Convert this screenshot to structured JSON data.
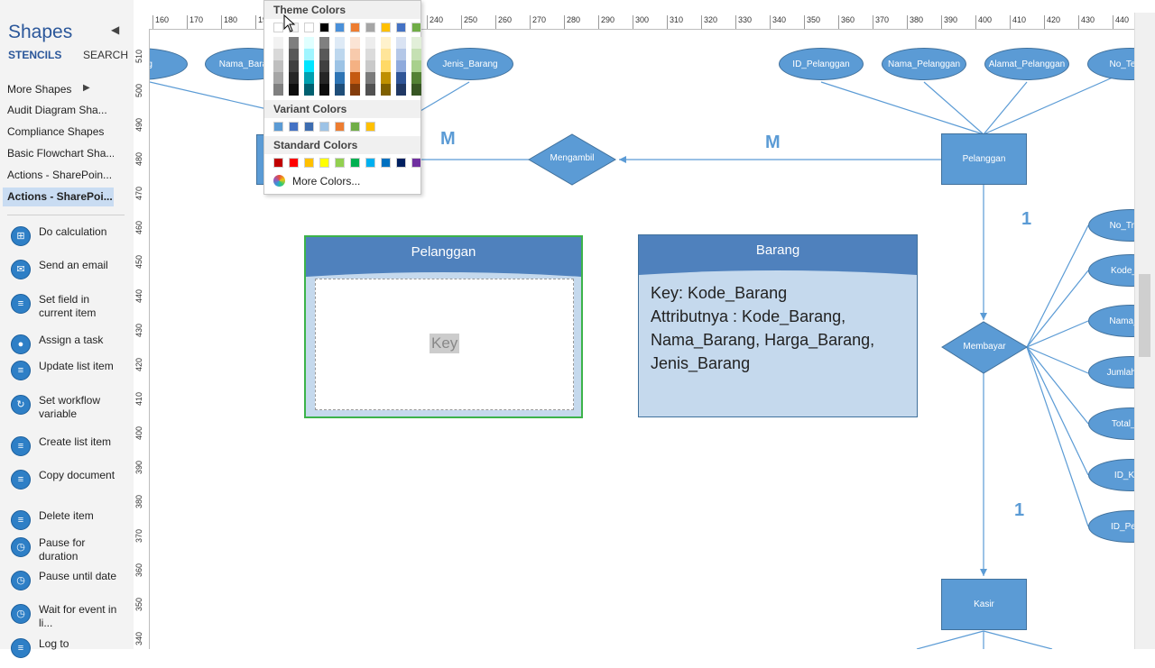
{
  "pane": {
    "title": "Shapes",
    "tab_stencils": "STENCILS",
    "tab_search": "SEARCH",
    "more_shapes": "More Shapes",
    "stencils": [
      {
        "label": "Audit Diagram Sha...",
        "active": false
      },
      {
        "label": "Compliance Shapes",
        "active": false
      },
      {
        "label": "Basic Flowchart Sha...",
        "active": false
      },
      {
        "label": "Actions - SharePoin...",
        "active": false
      },
      {
        "label": "Actions - SharePoi...",
        "active": true
      }
    ],
    "actions": [
      {
        "label": "Do calculation",
        "icon": "calculator-icon"
      },
      {
        "label": "Send an email",
        "icon": "email-icon"
      },
      {
        "label": "Set field in current item",
        "icon": "list-icon"
      },
      {
        "label": "Assign a task",
        "icon": "user-icon"
      },
      {
        "label": "Update list item",
        "icon": "list-icon"
      },
      {
        "label": "Set workflow variable",
        "icon": "variable-icon"
      },
      {
        "label": "Create list item",
        "icon": "list-icon"
      },
      {
        "label": "Copy document",
        "icon": "document-icon"
      },
      {
        "label": "Delete item",
        "icon": "list-icon"
      },
      {
        "label": "Pause for duration",
        "icon": "clock-icon"
      },
      {
        "label": "Pause until date",
        "icon": "clock-icon"
      },
      {
        "label": "Wait for event in li...",
        "icon": "clock-icon"
      },
      {
        "label": "Log to",
        "icon": "log-icon"
      }
    ]
  },
  "ruler": {
    "h_ticks": [
      "160",
      "170",
      "180",
      "190",
      "200",
      "210",
      "220",
      "230",
      "240",
      "250",
      "260",
      "270",
      "280",
      "290",
      "300",
      "310",
      "320",
      "330",
      "340",
      "350",
      "360",
      "370",
      "380",
      "390",
      "400",
      "410",
      "420",
      "430",
      "440"
    ],
    "v_ticks": [
      "510",
      "500",
      "490",
      "480",
      "470",
      "460",
      "450",
      "440",
      "430",
      "420",
      "410",
      "400",
      "390",
      "380",
      "370",
      "360",
      "350",
      "340"
    ]
  },
  "picker": {
    "theme_title": "Theme Colors",
    "variant_title": "Variant Colors",
    "standard_title": "Standard Colors",
    "more_colors": "More Colors...",
    "theme_top": [
      "#ffffff",
      "#f2f2f2",
      "#ffffff",
      "#000000",
      "#4a90d9",
      "#ed7d31",
      "#a5a5a5",
      "#ffc000",
      "#4472c4",
      "#70ad47"
    ],
    "theme_shades": [
      [
        "#f2f2f2",
        "#d9d9d9",
        "#bfbfbf",
        "#a6a6a6",
        "#808080"
      ],
      [
        "#7f7f7f",
        "#595959",
        "#404040",
        "#262626",
        "#0d0d0d"
      ],
      [
        "#e0ffff",
        "#a0f5ff",
        "#00e5ff",
        "#00a0b0",
        "#006070"
      ],
      [
        "#808080",
        "#595959",
        "#404040",
        "#262626",
        "#0d0d0d"
      ],
      [
        "#deeaf6",
        "#bdd7ee",
        "#9cc3e5",
        "#2e75b5",
        "#1f4e79"
      ],
      [
        "#fbe4d5",
        "#f7caac",
        "#f4b183",
        "#c55a11",
        "#843c0b"
      ],
      [
        "#ededed",
        "#dbdbdb",
        "#c9c9c9",
        "#7b7b7b",
        "#525252"
      ],
      [
        "#fff2cc",
        "#ffe599",
        "#ffd966",
        "#bf9000",
        "#7f6000"
      ],
      [
        "#dae3f3",
        "#b4c7e7",
        "#8faadc",
        "#2f5597",
        "#203864"
      ],
      [
        "#e2efd9",
        "#c5e0b3",
        "#a8d08d",
        "#538135",
        "#375623"
      ]
    ],
    "variant": [
      "#5b9bd5",
      "#4472c4",
      "#3e6db0",
      "#9dc3e6",
      "#ed7d31",
      "#70ad47",
      "#ffc000"
    ],
    "standard": [
      "#c00000",
      "#ff0000",
      "#ffc000",
      "#ffff00",
      "#92d050",
      "#00b050",
      "#00b0f0",
      "#0070c0",
      "#002060",
      "#7030a0"
    ]
  },
  "diagram": {
    "attr_left": [
      "...arang",
      "Nama_Barang",
      "Jenis_Barang"
    ],
    "attr_right": [
      "ID_Pelanggan",
      "Nama_Pelanggan",
      "Alamat_Pelanggan",
      "No_Tele..."
    ],
    "mengambil": "Mengambil",
    "pelanggan_rect": "Pelanggan",
    "membayar": "Membayar",
    "kasir": "Kasir",
    "card_m1": "M",
    "card_m2": "M",
    "card_1a": "1",
    "card_1b": "1",
    "trans_attrs": [
      "No_Tran...",
      "Kode_B...",
      "Nama_B...",
      "Jumlah_B...",
      "Total_H...",
      "ID_Ka...",
      "ID_Pela..."
    ],
    "entity_pelanggan": {
      "title": "Pelanggan",
      "placeholder": "Key"
    },
    "entity_barang": {
      "title": "Barang",
      "line1": "Key: Kode_Barang",
      "line2": "Attributnya : Kode_Barang,",
      "line3": "Nama_Barang, Harga_Barang,",
      "line4": "Jenis_Barang"
    }
  }
}
